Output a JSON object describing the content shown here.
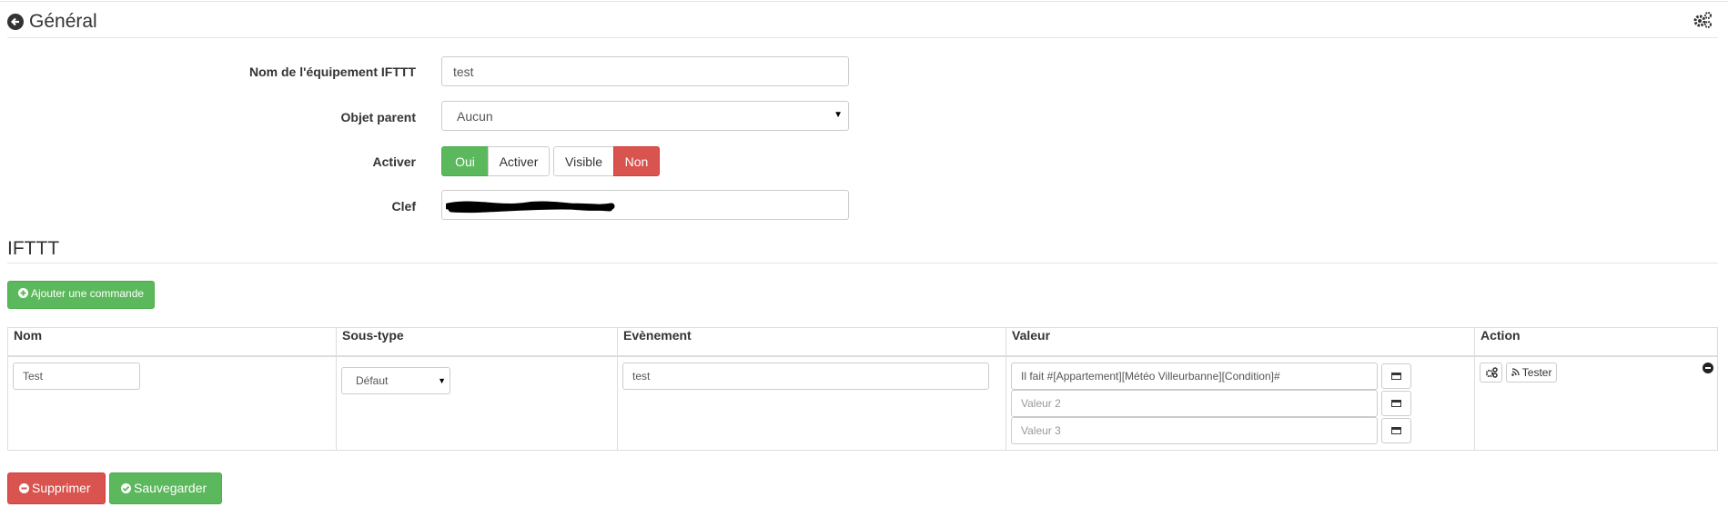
{
  "header": {
    "title": "Général"
  },
  "form": {
    "name_label": "Nom de l'équipement IFTTT",
    "name_value": "test",
    "parent_label": "Objet parent",
    "parent_value": "Aucun",
    "activer_label": "Activer",
    "activer_yes": "Oui",
    "activer_text": "Activer",
    "visible_text": "Visible",
    "visible_no": "Non",
    "key_label": "Clef"
  },
  "section": {
    "title": "IFTTT",
    "add_button": "Ajouter une commande"
  },
  "table": {
    "headers": [
      "Nom",
      "Sous-type",
      "Evènement",
      "Valeur",
      "Action"
    ],
    "row": {
      "name": "Test",
      "subtype": "Défaut",
      "event": "test",
      "value1": "Il fait #[Appartement][Météo Villeurbanne][Condition]#",
      "value2_placeholder": "Valeur 2",
      "value3_placeholder": "Valeur 3",
      "test_label": "Tester"
    }
  },
  "actions": {
    "delete_label": "Supprimer",
    "save_label": "Sauvegarder"
  },
  "colors": {
    "success": "#5cb85c",
    "danger": "#d9534f"
  }
}
